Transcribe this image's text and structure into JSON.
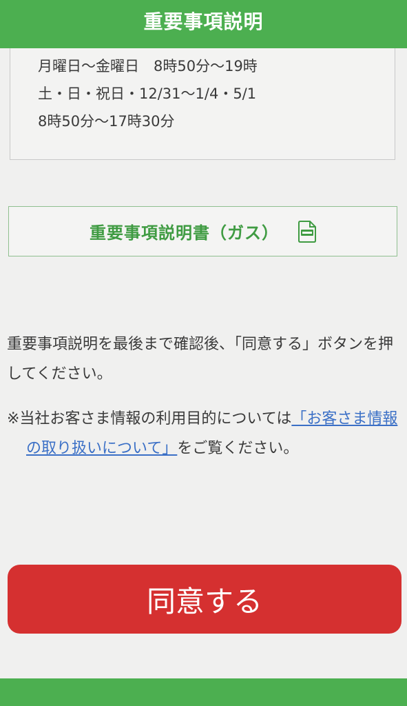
{
  "header": {
    "title": "重要事項説明"
  },
  "hours": {
    "line1": "月曜日～金曜日　8時50分～19時",
    "line2": "土・日・祝日・12/31～1/4・5/1",
    "line3": "8時50分～17時30分"
  },
  "pdf_link": {
    "label": "重要事項説明書（ガス）",
    "icon": "pdf-file-icon"
  },
  "instruction": {
    "text": "重要事項説明を最後まで確認後、「同意する」ボタンを押してください。"
  },
  "note": {
    "prefix": "※当社お客さま情報の利用目的については",
    "link_text": "「お客さま情報の取り扱いについて」",
    "suffix": "をご覧ください。"
  },
  "agree_button": {
    "label": "同意する"
  },
  "colors": {
    "header_green": "#4caf50",
    "link_green": "#3f9b42",
    "agree_red": "#d53030",
    "link_blue": "#3a6fc6"
  }
}
